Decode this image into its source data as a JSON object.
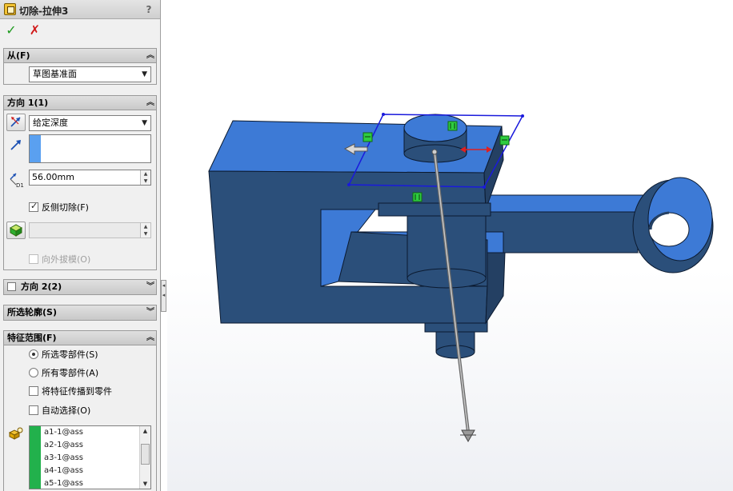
{
  "panel": {
    "title": "切除-拉伸3",
    "help_label": "?",
    "ok_label": "✓",
    "cancel_label": "✗"
  },
  "from_group": {
    "header": "从(F)",
    "start_condition": "草图基准面"
  },
  "direction1": {
    "header": "方向 1(1)",
    "end_condition": "给定深度",
    "depth_value": "56.00mm",
    "depth_icon_label": "D1",
    "flip_side_cut_label": "反侧切除(F)",
    "flip_side_cut_checked": true,
    "draft_outward_label": "向外拔模(O)",
    "draft_outward_enabled": false
  },
  "direction2": {
    "header": "方向 2(2)",
    "checked": false
  },
  "selected_contours": {
    "header": "所选轮廓(S)"
  },
  "feature_scope": {
    "header": "特征范围(F)",
    "option_selected": "所选零部件(S)",
    "option_all": "所有零部件(A)",
    "propagate_label": "将特征传播到零件",
    "auto_select_label": "自动选择(O)",
    "components": [
      "a1-1@ass",
      "a2-1@ass",
      "a3-1@ass",
      "a4-1@ass",
      "a5-1@ass"
    ]
  },
  "colors": {
    "part_face": "#3d7ad6",
    "part_dark": "#2b4f7a",
    "sketch_plane": "#1a1adc",
    "handle_green": "#2ecc40",
    "arrow_red": "#e02020",
    "selection_bar": "#22b14c"
  }
}
